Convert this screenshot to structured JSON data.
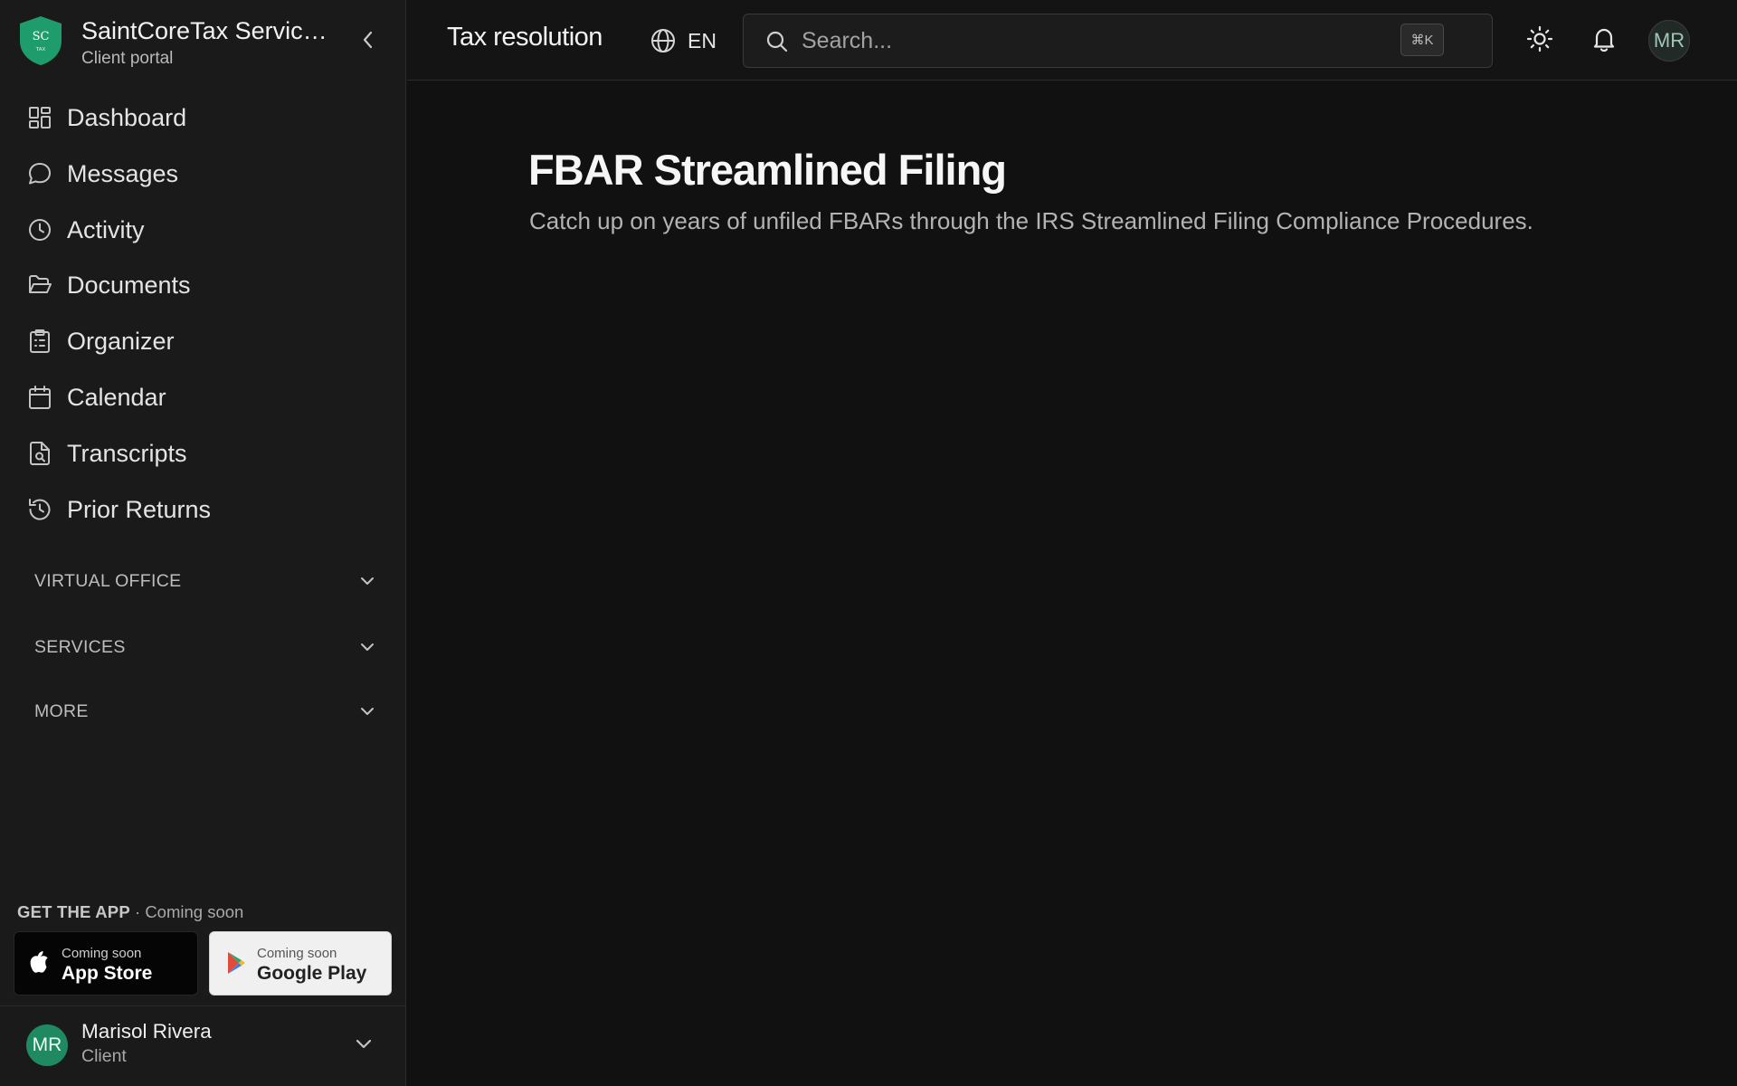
{
  "brand": {
    "logo_text": "SC",
    "logo_subtext": "TAX",
    "name": "SaintCoreTax Servic…",
    "subtitle": "Client portal",
    "accent_color": "#1f9c6b"
  },
  "nav": {
    "items": [
      {
        "label": "Dashboard",
        "icon": "dashboard-icon"
      },
      {
        "label": "Messages",
        "icon": "message-bubble-icon"
      },
      {
        "label": "Activity",
        "icon": "clock-icon"
      },
      {
        "label": "Documents",
        "icon": "folder-open-icon"
      },
      {
        "label": "Organizer",
        "icon": "clipboard-list-icon"
      },
      {
        "label": "Calendar",
        "icon": "calendar-icon"
      },
      {
        "label": "Transcripts",
        "icon": "file-search-icon"
      },
      {
        "label": "Prior Returns",
        "icon": "history-icon"
      }
    ],
    "sections": [
      {
        "label": "VIRTUAL OFFICE"
      },
      {
        "label": "SERVICES"
      },
      {
        "label": "MORE"
      }
    ]
  },
  "get_app": {
    "label": "GET THE APP",
    "status": "· Coming soon",
    "app_store": {
      "small": "Coming soon",
      "big": "App Store"
    },
    "google_play": {
      "small": "Coming soon",
      "big": "Google Play"
    }
  },
  "user": {
    "initials": "MR",
    "name": "Marisol Rivera",
    "role": "Client"
  },
  "topbar": {
    "title": "Tax resolution",
    "language": "EN",
    "search_placeholder": "Search...",
    "shortcut": "⌘K",
    "avatar_initials": "MR"
  },
  "main": {
    "title": "FBAR Streamlined Filing",
    "subtitle": "Catch up on years of unfiled FBARs through the IRS Streamlined Filing Compliance Procedures."
  }
}
